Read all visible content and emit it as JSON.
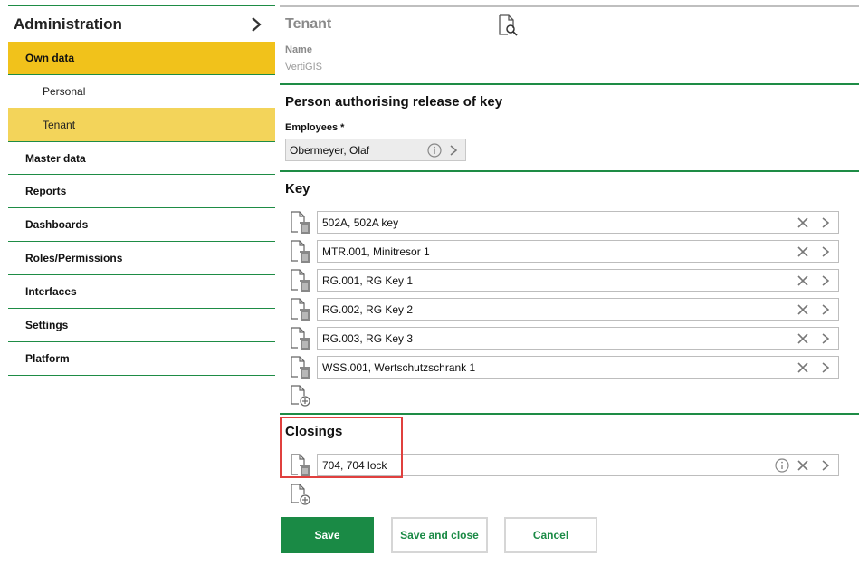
{
  "sidebar": {
    "title": "Administration",
    "items": [
      {
        "label": "Own data"
      },
      {
        "label": "Personal"
      },
      {
        "label": "Tenant"
      },
      {
        "label": "Master data"
      },
      {
        "label": "Reports"
      },
      {
        "label": "Dashboards"
      },
      {
        "label": "Roles/Permissions"
      },
      {
        "label": "Interfaces"
      },
      {
        "label": "Settings"
      },
      {
        "label": "Platform"
      }
    ]
  },
  "main": {
    "title": "Tenant",
    "name_label": "Name",
    "name_value": "VertiGIS",
    "section_person": "Person authorising release of key",
    "employees_label": "Employees *",
    "employees_value": "Obermeyer, Olaf",
    "section_key": "Key",
    "keys": [
      "502A, 502A key",
      "MTR.001, Minitresor 1",
      "RG.001, RG Key 1",
      "RG.002, RG Key 2",
      "RG.003, RG Key 3",
      "WSS.001, Wertschutzschrank 1"
    ],
    "section_closings": "Closings",
    "closings": [
      "704, 704 lock"
    ]
  },
  "buttons": {
    "save": "Save",
    "save_close": "Save and close",
    "cancel": "Cancel"
  },
  "colors": {
    "accent_green": "#1a8a45",
    "active_yellow": "#f1c21b",
    "sub_active_yellow": "#f3d45a",
    "highlight_red": "#e0403e"
  },
  "icons": {
    "header_action": "document-search-icon",
    "row_leading": "file-delete-icon",
    "row_clear": "close-icon",
    "row_open": "chevron-right-icon",
    "row_info": "info-icon",
    "add": "file-add-icon"
  }
}
